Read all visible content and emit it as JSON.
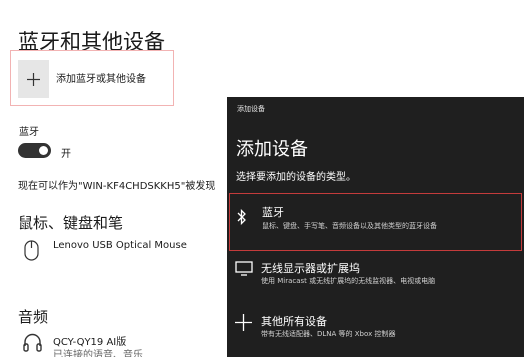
{
  "settings": {
    "title": "蓝牙和其他设备",
    "add_device_label": "添加蓝牙或其他设备",
    "bluetooth_label": "蓝牙",
    "bluetooth_toggle_state": "开",
    "discoverable_text": "现在可以作为\"WIN-KF4CHDSKKH5\"被发现",
    "section_mouse": "鼠标、键盘和笔",
    "mouse_device": "Lenovo USB Optical Mouse",
    "section_audio": "音频",
    "audio_device": "QCY-QY19  AI版",
    "audio_status": "已连接的语音、音乐"
  },
  "dialog": {
    "caption": "添加设备",
    "title": "添加设备",
    "subtitle": "选择要添加的设备的类型。",
    "options": [
      {
        "icon": "bluetooth-icon",
        "title": "蓝牙",
        "desc": "鼠标、键盘、手写笔、音频设备以及其他类型的蓝牙设备"
      },
      {
        "icon": "monitor-icon",
        "title": "无线显示器或扩展坞",
        "desc": "使用 Miracast 或无线扩展坞的无线监视器、电视或电脑"
      },
      {
        "icon": "plus-icon",
        "title": "其他所有设备",
        "desc": "带有无线适配器、DLNA 等的 Xbox 控制器"
      }
    ]
  },
  "colors": {
    "dialog_bg": "#1f1f1f",
    "highlight_border": "#c43b3b",
    "toggle_on": "#333333"
  }
}
